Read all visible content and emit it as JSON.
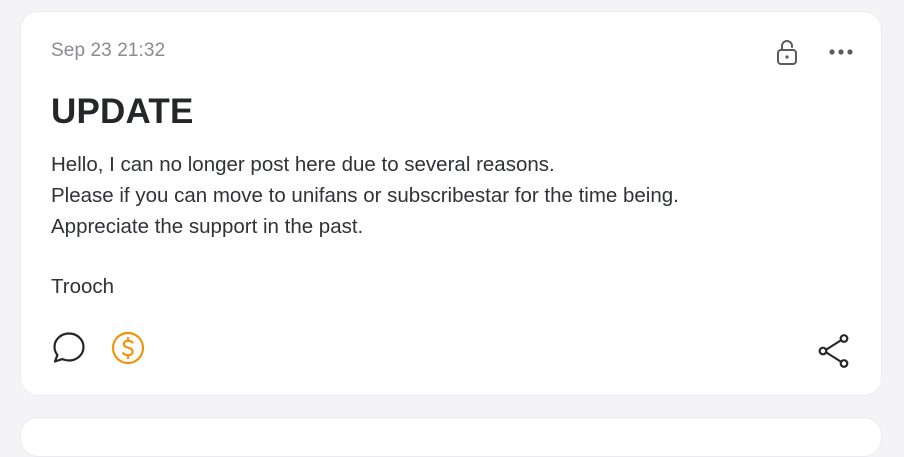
{
  "post": {
    "date": "Sep 23 21:32",
    "title": "UPDATE",
    "lines": [
      "Hello, I can no longer post here due to several reasons.",
      "Please if you can move to unifans or subscribestar for the time being.",
      "Appreciate the support in the past."
    ],
    "signature": "Trooch"
  },
  "icons": {
    "lock": "lock-open-icon",
    "more": "more-dots-icon",
    "comment": "comment-bubble-icon",
    "tip": "dollar-coin-icon",
    "share": "share-icon"
  },
  "colors": {
    "tip_accent": "#f0950a",
    "text": "#24262a",
    "muted": "#8a8a90"
  }
}
